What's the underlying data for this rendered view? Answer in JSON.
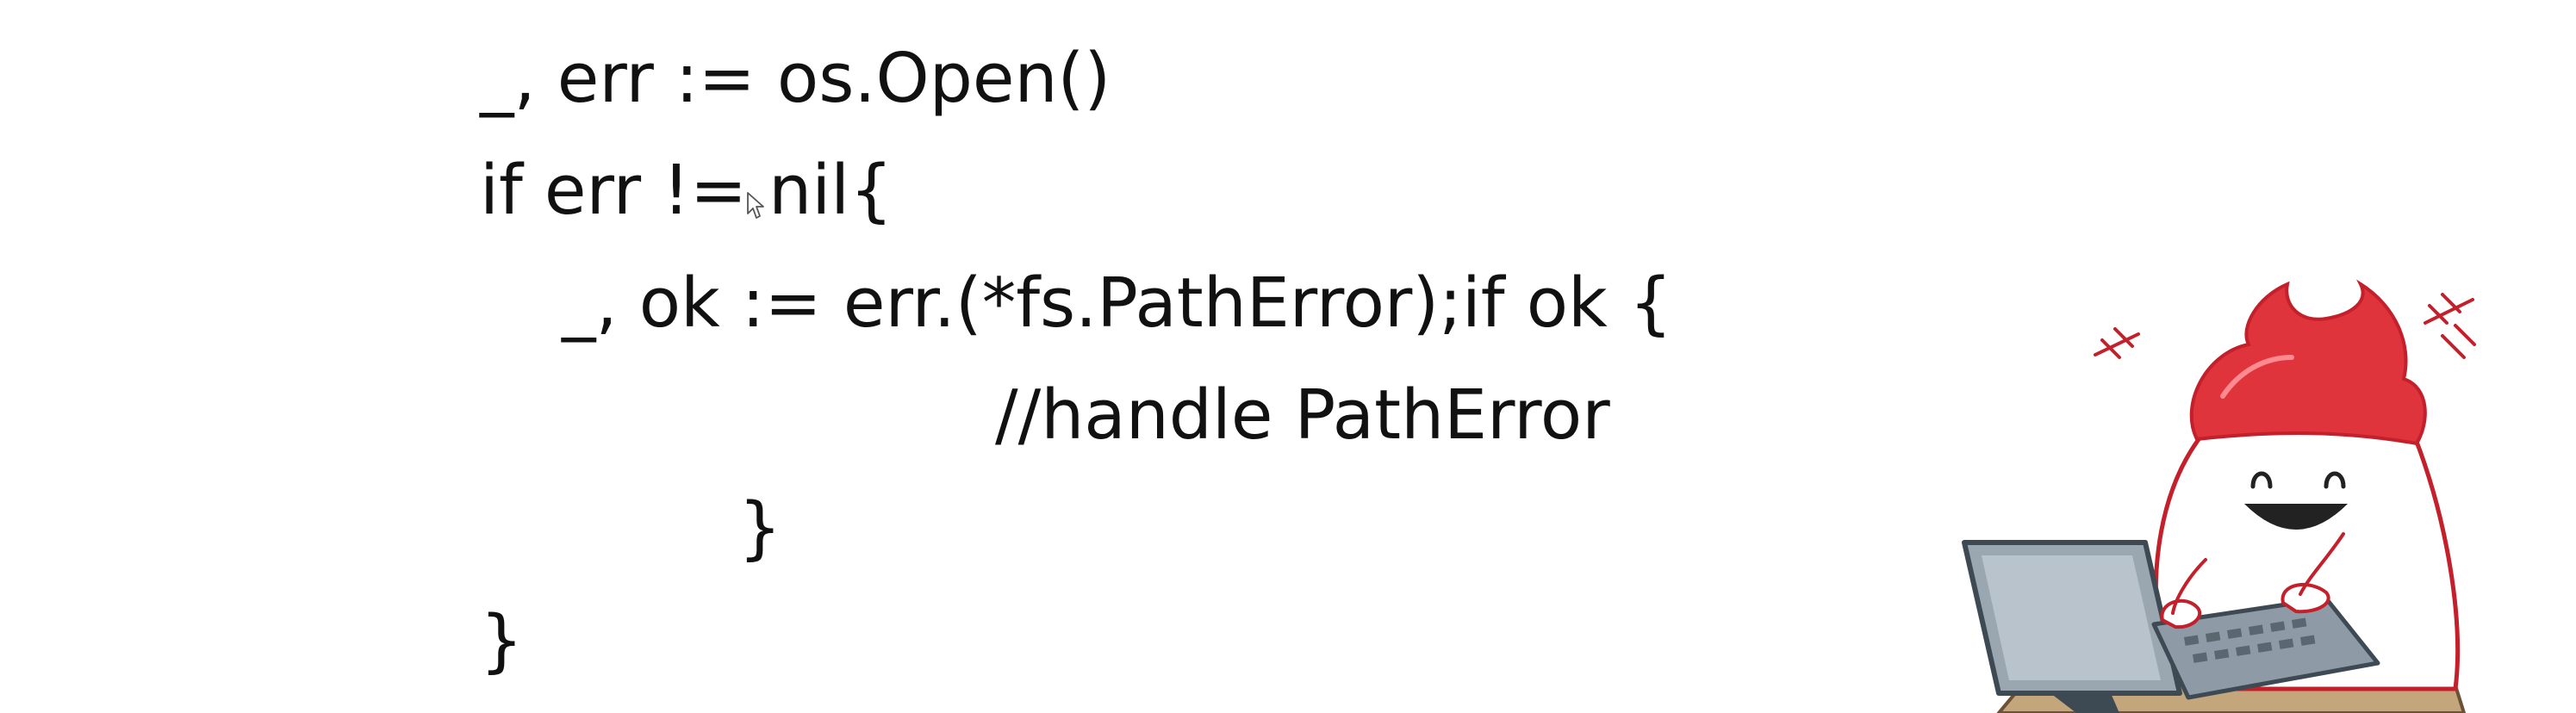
{
  "code": {
    "lines": [
      "_, err := os.Open()",
      "if err != nil{",
      "_, ok := err.(*fs.PathError);if ok {",
      "//handle PathError",
      "}",
      "}"
    ]
  },
  "icons": {
    "cursor": "mouse-pointer-icon",
    "mascot": "gopher-mascot-at-laptop"
  },
  "colors": {
    "background": "#ffffff",
    "text": "#111111",
    "mascot_hair": "#e0343d",
    "mascot_outline": "#c3202b",
    "laptop": "#8e9ba6",
    "desk": "#b99a72"
  }
}
